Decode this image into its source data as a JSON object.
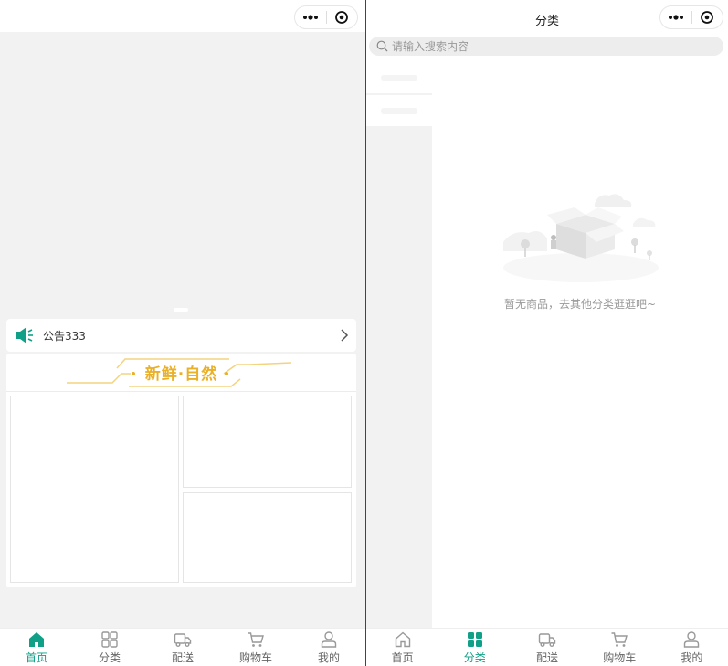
{
  "left": {
    "notice": {
      "text": "公告333"
    },
    "promo": {
      "title": "新鲜·自然"
    }
  },
  "right": {
    "title": "分类",
    "search": {
      "placeholder": "请输入搜索内容"
    },
    "empty": {
      "text": "暂无商品，去其他分类逛逛吧~"
    }
  },
  "tabbar_left": [
    {
      "label": "首页",
      "icon": "home-icon",
      "active": true
    },
    {
      "label": "分类",
      "icon": "category-icon",
      "active": false
    },
    {
      "label": "配送",
      "icon": "truck-icon",
      "active": false
    },
    {
      "label": "购物车",
      "icon": "cart-icon",
      "active": false
    },
    {
      "label": "我的",
      "icon": "user-icon",
      "active": false
    }
  ],
  "tabbar_right": [
    {
      "label": "首页",
      "icon": "home-icon",
      "active": false
    },
    {
      "label": "分类",
      "icon": "category-icon",
      "active": true
    },
    {
      "label": "配送",
      "icon": "truck-icon",
      "active": false
    },
    {
      "label": "购物车",
      "icon": "cart-icon",
      "active": false
    },
    {
      "label": "我的",
      "icon": "user-icon",
      "active": false
    }
  ],
  "colors": {
    "accent": "#10a087",
    "promo_gold": "#eab027"
  }
}
